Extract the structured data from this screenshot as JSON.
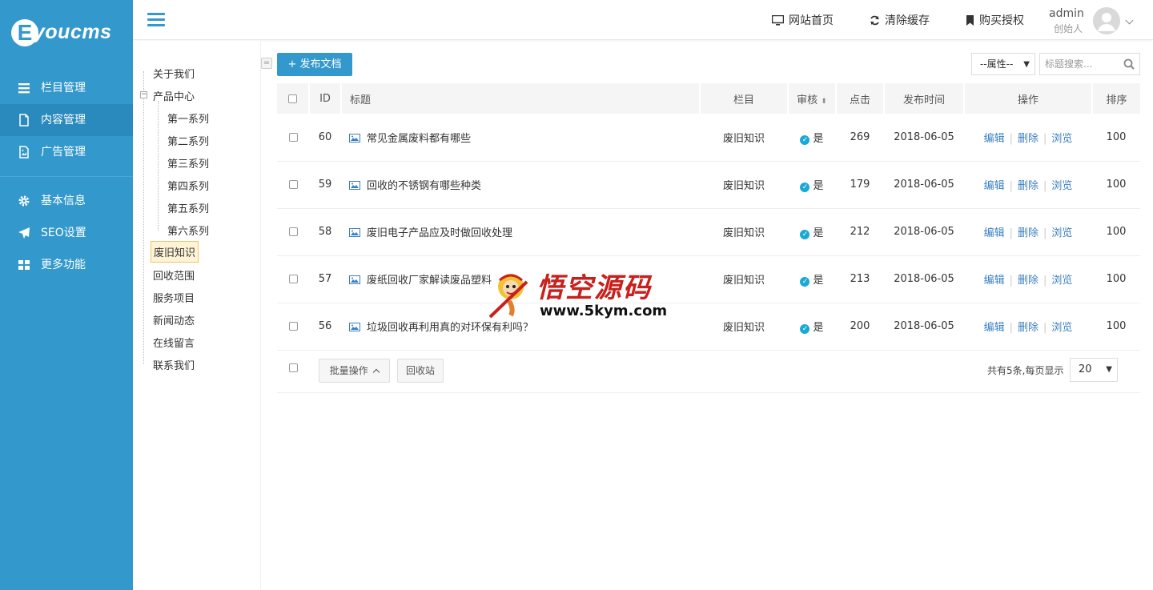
{
  "app": {
    "logo_letter": "E",
    "logo_word": "youcms"
  },
  "colors": {
    "primary": "#3398cc",
    "link": "#3a7fc2",
    "status": "#19a9d5"
  },
  "sidebar": {
    "items": [
      {
        "label": "栏目管理",
        "icon": "list-icon",
        "active": false
      },
      {
        "label": "内容管理",
        "icon": "document-icon",
        "active": true
      },
      {
        "label": "广告管理",
        "icon": "image-icon",
        "active": false
      }
    ],
    "items2": [
      {
        "label": "基本信息",
        "icon": "gear-icon"
      },
      {
        "label": "SEO设置",
        "icon": "paper-plane-icon"
      },
      {
        "label": "更多功能",
        "icon": "grid-icon"
      }
    ]
  },
  "topbar": {
    "site_home": "网站首页",
    "clear_cache": "清除缓存",
    "buy_license": "购买授权",
    "admin_name": "admin",
    "admin_role": "创始人"
  },
  "tree": {
    "about": "关于我们",
    "products": "产品中心",
    "series": [
      "第一系列",
      "第二系列",
      "第三系列",
      "第四系列",
      "第五系列",
      "第六系列"
    ],
    "others": [
      "废旧知识",
      "回收范围",
      "服务项目",
      "新闻动态",
      "在线留言",
      "联系我们"
    ]
  },
  "toolbar": {
    "add_label": "+ 发布文档",
    "attr_select": "--属性--",
    "search_placeholder": "标题搜索..."
  },
  "table": {
    "headers": {
      "id": "ID",
      "title": "标题",
      "column": "栏目",
      "audit": "审核",
      "clicks": "点击",
      "date": "发布时间",
      "ops": "操作",
      "sort": "排序"
    },
    "rows": [
      {
        "id": "60",
        "title": "常见金属废料都有哪些",
        "column": "废旧知识",
        "audit": "是",
        "clicks": "269",
        "date": "2018-06-05",
        "sort": "100"
      },
      {
        "id": "59",
        "title": "回收的不锈钢有哪些种类",
        "column": "废旧知识",
        "audit": "是",
        "clicks": "179",
        "date": "2018-06-05",
        "sort": "100"
      },
      {
        "id": "58",
        "title": "废旧电子产品应及时做回收处理",
        "column": "废旧知识",
        "audit": "是",
        "clicks": "212",
        "date": "2018-06-05",
        "sort": "100"
      },
      {
        "id": "57",
        "title": "废纸回收厂家解读废品塑料",
        "column": "废旧知识",
        "audit": "是",
        "clicks": "213",
        "date": "2018-06-05",
        "sort": "100"
      },
      {
        "id": "56",
        "title": "垃圾回收再利用真的对环保有利吗？",
        "column": "废旧知识",
        "audit": "是",
        "clicks": "200",
        "date": "2018-06-05",
        "sort": "100"
      }
    ],
    "op_labels": {
      "edit": "编辑",
      "delete": "删除",
      "view": "浏览"
    }
  },
  "footer": {
    "batch_label": "批量操作",
    "recycle_label": "回收站",
    "page_info": "共有5条,每页显示",
    "page_size": "20"
  },
  "watermark": {
    "text_zh": "悟空源码",
    "url": "www.5kym.com"
  }
}
